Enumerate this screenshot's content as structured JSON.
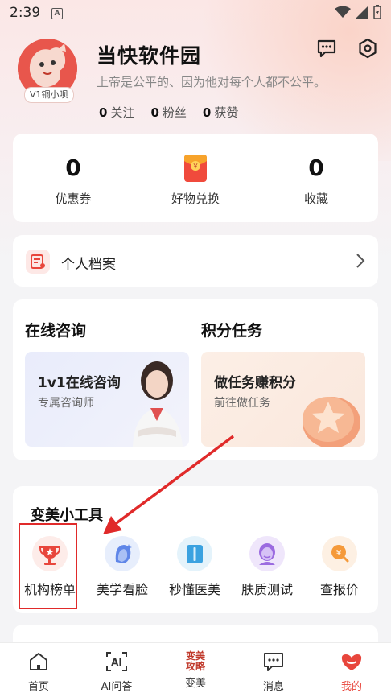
{
  "status_bar": {
    "time": "2:39",
    "notification_icon": "A"
  },
  "profile": {
    "name": "当快软件园",
    "motto": "上帝是公平的、因为他对每个人都不公平。",
    "badge": "V1铜小呗",
    "stats": [
      {
        "value": "0",
        "label": "关注"
      },
      {
        "value": "0",
        "label": "粉丝"
      },
      {
        "value": "0",
        "label": "获赞"
      }
    ]
  },
  "summary": {
    "coupons": {
      "value": "0",
      "label": "优惠券"
    },
    "exchange": {
      "label": "好物兑换"
    },
    "favorites": {
      "value": "0",
      "label": "收藏"
    }
  },
  "archive": {
    "label": "个人档案"
  },
  "consult": {
    "title": "在线咨询",
    "tile_title": "1v1在线咨询",
    "tile_sub": "专属咨询师"
  },
  "points": {
    "title": "积分任务",
    "tile_title": "做任务赚积分",
    "tile_sub": "前往做任务"
  },
  "tools": {
    "title": "变美小工具",
    "items": [
      {
        "label": "机构榜单",
        "icon": "trophy-icon"
      },
      {
        "label": "美学看脸",
        "icon": "face-icon"
      },
      {
        "label": "秒懂医美",
        "icon": "book-icon"
      },
      {
        "label": "肤质测试",
        "icon": "skin-icon"
      },
      {
        "label": "查报价",
        "icon": "price-icon"
      }
    ]
  },
  "bottom_nav": {
    "items": [
      {
        "label": "首页",
        "icon": "home-icon"
      },
      {
        "label": "AI问答",
        "icon": "ai-icon"
      },
      {
        "label": "变美",
        "icon": "beauty-icon",
        "icon_text": "变美攻略"
      },
      {
        "label": "消息",
        "icon": "message-icon"
      },
      {
        "label": "我的",
        "icon": "mine-icon"
      }
    ],
    "active_index": 4
  },
  "colors": {
    "accent": "#e8463c",
    "annotation": "#e02a2a"
  }
}
